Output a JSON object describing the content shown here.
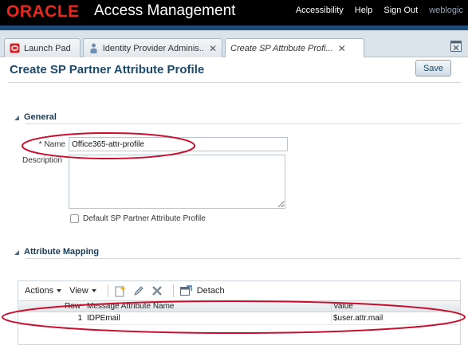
{
  "header": {
    "brand": "ORACLE",
    "app_title": "Access Management",
    "links": [
      "Accessibility",
      "Help",
      "Sign Out"
    ],
    "user": "weblogic"
  },
  "tabs": [
    {
      "label": "Launch Pad",
      "icon": "launch-pad-icon"
    },
    {
      "label": "Identity Provider Adminis...",
      "icon": "person-icon"
    },
    {
      "label": "Create SP Attribute Profi...",
      "icon": "",
      "active": true
    }
  ],
  "page": {
    "title": "Create SP Partner Attribute Profile",
    "save_label": "Save"
  },
  "general": {
    "heading": "General",
    "name_required_mark": "*",
    "name_label": "Name",
    "name_value": "Office365-attr-profile",
    "description_label": "Description",
    "default_checkbox_label": "Default SP Partner Attribute Profile",
    "default_checked": false
  },
  "attribute_mapping": {
    "heading": "Attribute Mapping",
    "toolbar": {
      "actions_label": "Actions",
      "view_label": "View",
      "detach_label": "Detach",
      "icons": [
        "add-icon",
        "edit-pencil-icon",
        "delete-x-icon",
        "detach-icon"
      ]
    },
    "columns": [
      "Row",
      "Message Attribute Name",
      "Value"
    ],
    "rows": [
      {
        "row": "1",
        "name": "IDPEmail",
        "value": "$user.attr.mail"
      }
    ]
  },
  "colors": {
    "brand_red": "#e8281f",
    "header_bg": "#000000",
    "header_strip": "#1e4a78",
    "title_blue": "#1b4a6b",
    "annotation_red": "#c8102e"
  }
}
